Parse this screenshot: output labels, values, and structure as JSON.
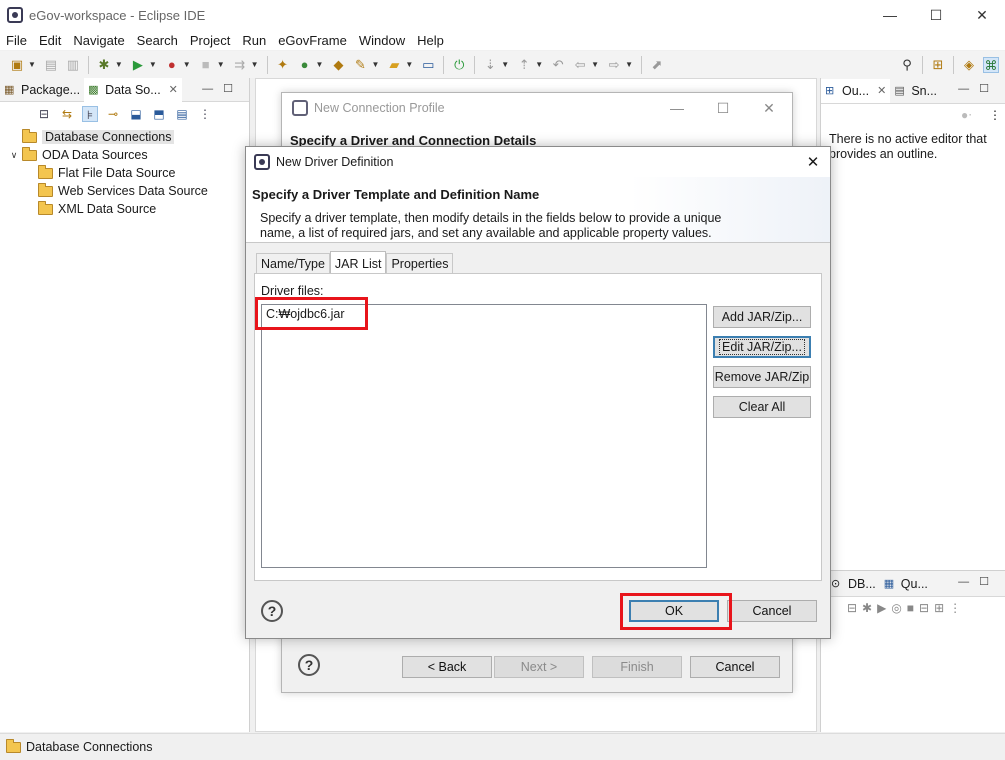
{
  "window": {
    "title": "eGov-workspace - Eclipse IDE",
    "controls": [
      "—",
      "☐",
      "✕"
    ]
  },
  "menu": [
    "File",
    "Edit",
    "Navigate",
    "Search",
    "Project",
    "Run",
    "eGovFrame",
    "Window",
    "Help"
  ],
  "left_panel": {
    "tabs": [
      {
        "label": "Package...",
        "icon": "package-explorer-icon"
      },
      {
        "label": "Data So...",
        "icon": "data-source-icon",
        "close": "✕"
      }
    ],
    "tree": [
      {
        "label": "Database Connections",
        "level": 0,
        "selected": true
      },
      {
        "label": "ODA Data Sources",
        "level": 0,
        "expanded": true
      },
      {
        "label": "Flat File Data Source",
        "level": 1
      },
      {
        "label": "Web Services Data Source",
        "level": 1
      },
      {
        "label": "XML Data Source",
        "level": 1
      }
    ]
  },
  "right_panel": {
    "tabs": [
      {
        "label": "Ou...",
        "close": "✕"
      },
      {
        "label": "Sn..."
      }
    ],
    "message": "There is no active editor that provides an outline."
  },
  "bottom_right_panel": {
    "tabs": [
      {
        "label": "DB..."
      },
      {
        "label": "Qu..."
      }
    ]
  },
  "status_bar": {
    "text": "Database Connections"
  },
  "bg_dialog": {
    "title": "New Connection Profile",
    "heading": "Specify a Driver and Connection Details",
    "buttons": {
      "back": "< Back",
      "next": "Next >",
      "finish": "Finish",
      "cancel": "Cancel"
    }
  },
  "dialog": {
    "title": "New Driver Definition",
    "heading": "Specify a Driver Template and Definition Name",
    "description": "Specify a driver template, then modify details in the fields below to provide a unique name, a list of required jars, and set any available and applicable property values.",
    "tabs": [
      "Name/Type",
      "JAR List",
      "Properties"
    ],
    "active_tab": "JAR List",
    "driver_files_label": "Driver files:",
    "driver_files": [
      "C:₩ojdbc6.jar"
    ],
    "side_buttons": {
      "add": "Add JAR/Zip...",
      "edit": "Edit JAR/Zip...",
      "remove": "Remove JAR/Zip",
      "clear": "Clear All"
    },
    "ok": "OK",
    "cancel": "Cancel",
    "help": "?"
  },
  "colors": {
    "highlight": "#e8141b",
    "folder": "#f3c54f",
    "focus": "#3c7fb1"
  }
}
